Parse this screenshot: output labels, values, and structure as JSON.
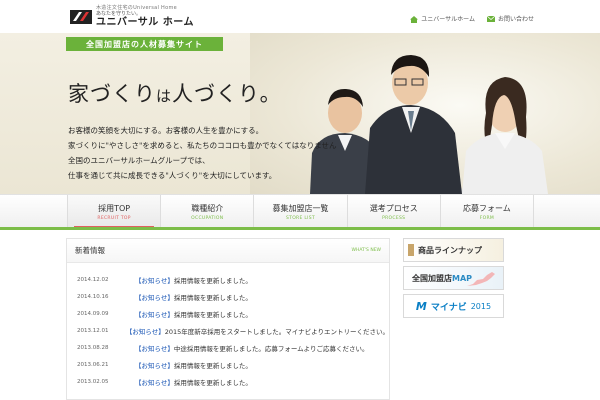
{
  "header": {
    "logo_sub": "木造注文住宅のUniversal Home",
    "logo_tagline": "あなたを守りたい。",
    "logo_name": "ユニバーサル ホーム",
    "links": [
      {
        "label": "ユニバーサルホーム",
        "icon": "home-icon"
      },
      {
        "label": "お問い合わせ",
        "icon": "mail-icon"
      }
    ]
  },
  "hero": {
    "site_label": "全国加盟店の人材募集サイト",
    "catch_a": "家づくり",
    "catch_b": "は",
    "catch_c": "人づくり",
    "catch_d": "。",
    "lead": [
      "お客様の笑顔を大切にする。お客様の人生を豊かにする。",
      "家づくりに\"やさしさ\"を求めると、私たちのココロも豊かでなくてはなりません",
      "全国のユニバーサルホームグループでは、",
      "仕事を通じて共に成長できる\"人づくり\"を大切にしています。"
    ]
  },
  "nav": [
    {
      "jp": "採用TOP",
      "en": "RECRUIT TOP",
      "active": true
    },
    {
      "jp": "職種紹介",
      "en": "OCCUPATION",
      "active": false
    },
    {
      "jp": "募集加盟店一覧",
      "en": "STORE LIST",
      "active": false
    },
    {
      "jp": "選考プロセス",
      "en": "PROCESS",
      "active": false
    },
    {
      "jp": "応募フォーム",
      "en": "FORM",
      "active": false
    }
  ],
  "news": {
    "title": "新着情報",
    "more": "WHAT'S NEW",
    "items": [
      {
        "date": "2014.12.02",
        "cat": "【お知らせ】",
        "text": "採用情報を更新しました。"
      },
      {
        "date": "2014.10.16",
        "cat": "【お知らせ】",
        "text": "採用情報を更新しました。"
      },
      {
        "date": "2014.09.09",
        "cat": "【お知らせ】",
        "text": "採用情報を更新しました。"
      },
      {
        "date": "2013.12.01",
        "cat": "【お知らせ】",
        "text": "2015年度新卒採用をスタートしました。マイナビよりエントリーください。"
      },
      {
        "date": "2013.08.28",
        "cat": "【お知らせ】",
        "text": "中途採用情報を更新しました。応募フォームよりご応募ください。"
      },
      {
        "date": "2013.06.21",
        "cat": "【お知らせ】",
        "text": "採用情報を更新しました。"
      },
      {
        "date": "2013.02.05",
        "cat": "【お知らせ】",
        "text": "採用情報を更新しました。"
      }
    ]
  },
  "side": {
    "banner1": "商品ラインナップ",
    "banner2_a": "全国加盟店",
    "banner2_b": "MAP",
    "banner3_name": "マイナビ",
    "banner3_year": "2015"
  },
  "colors": {
    "green": "#6bb23a",
    "red": "#e06060",
    "link_blue": "#1a56b5"
  }
}
